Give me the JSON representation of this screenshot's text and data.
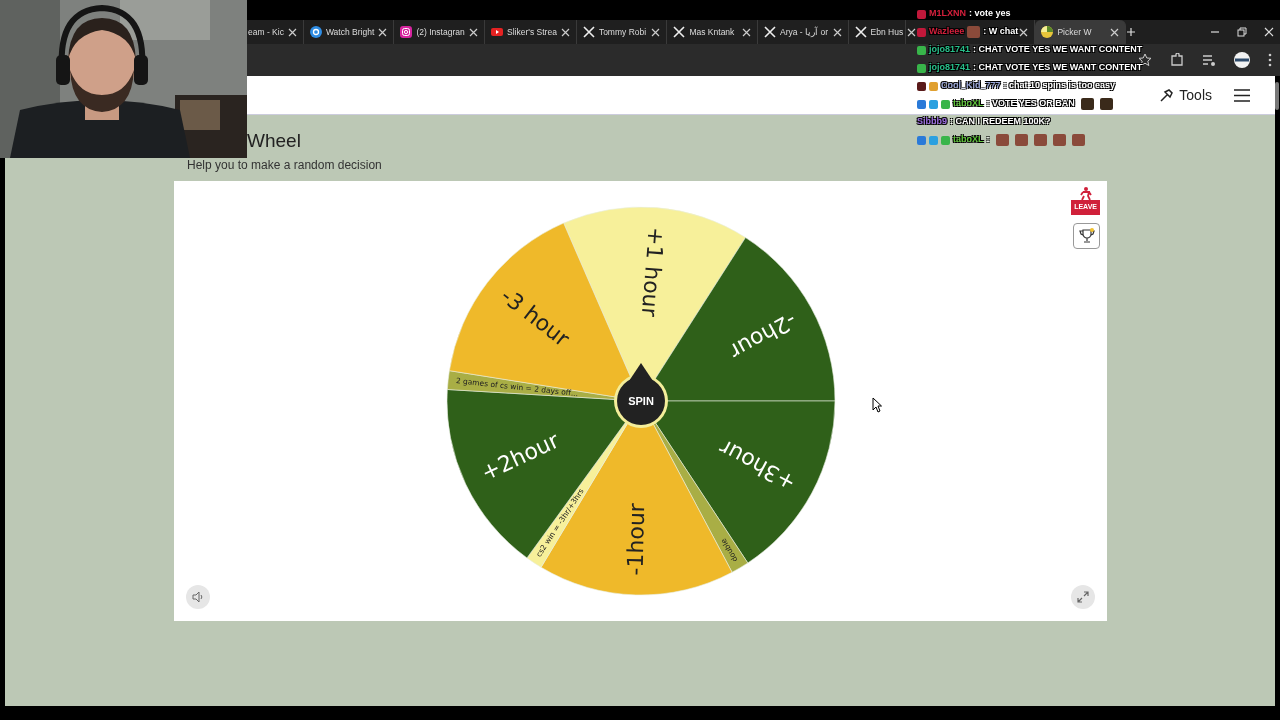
{
  "browser": {
    "tabs": [
      {
        "title": "eam - Kic",
        "kind": "plain",
        "selected": false
      },
      {
        "title": "Watch Bright",
        "kind": "ring",
        "selected": false
      },
      {
        "title": "(2) Instagran",
        "kind": "camera",
        "selected": false
      },
      {
        "title": "Sliker's Strea",
        "kind": "play",
        "selected": false
      },
      {
        "title": "Tommy Robi",
        "kind": "x",
        "selected": false
      },
      {
        "title": "Mas Kntank",
        "kind": "x",
        "selected": false
      },
      {
        "title": "Arya - آريا or",
        "kind": "x",
        "selected": false
      },
      {
        "title": "Ebn Hus",
        "kind": "x",
        "selected": false
      },
      {
        "kind": "plain",
        "selected": false
      },
      {
        "title": "Picker W",
        "kind": "wheel",
        "selected": true
      }
    ]
  },
  "chat": [
    {
      "badges": [
        {
          "color": "#c0183a"
        }
      ],
      "user": "M1LXNN",
      "color": "#d4203c",
      "message": ": vote yes"
    },
    {
      "badges": [
        {
          "color": "#c0183a"
        }
      ],
      "user": "Wazleee",
      "color": "#d4203c",
      "emotes": [
        {
          "kind": "box"
        }
      ],
      "message": ": W chat"
    },
    {
      "badges": [
        {
          "color": "#38b54a"
        }
      ],
      "user": "jojo81741",
      "color": "#27c08a",
      "message": ": CHAT VOTE YES WE WANT CONTENT"
    },
    {
      "badges": [
        {
          "color": "#38b54a"
        }
      ],
      "user": "jojo81741",
      "color": "#27c08a",
      "message": ": CHAT VOTE YES WE WANT CONTENT"
    },
    {
      "badges": [
        {
          "color": "#5a1a1a"
        },
        {
          "color": "#e0a030"
        }
      ],
      "user": "Cool_Kid_777",
      "color": "#9aa6d8",
      "message": ": chat 10 spins is too easy"
    },
    {
      "badges": [
        {
          "color": "#2a7ad8"
        },
        {
          "color": "#2aa0e0"
        },
        {
          "color": "#38b54a"
        }
      ],
      "user": "taboXL",
      "color": "#5ec43a",
      "message": ": VOTE YES OR BAN",
      "emotes_after": [
        {
          "kind": "mask"
        },
        {
          "kind": "mask"
        }
      ]
    },
    {
      "user": "Sibbb9",
      "color": "#9b6ce0",
      "message": ": CAN I REDEEM 100K?"
    },
    {
      "badges": [
        {
          "color": "#2a7ad8"
        },
        {
          "color": "#2aa0e0"
        },
        {
          "color": "#38b54a"
        }
      ],
      "user": "taboXL",
      "color": "#5ec43a",
      "message": ":",
      "emotes_after": [
        {
          "kind": "box"
        },
        {
          "kind": "box"
        },
        {
          "kind": "box"
        },
        {
          "kind": "box"
        },
        {
          "kind": "box"
        }
      ]
    }
  ],
  "page": {
    "tools": "Tools",
    "title": "Wheel",
    "subtitle": "Help you to make a random decision",
    "leave": "LEAVE",
    "spin": "SPIN",
    "segments": [
      {
        "label": "+1 hour",
        "color": "#f7f09a",
        "kind": "wide"
      },
      {
        "label": "-2hour",
        "color": "#2f6019",
        "kind": "wide"
      },
      {
        "label": "+3hour",
        "color": "#2f6019",
        "kind": "wide"
      },
      {
        "label": "double",
        "color": "#a9ae45",
        "kind": "narrow"
      },
      {
        "label": "-1hour",
        "color": "#efb92a",
        "kind": "wide"
      },
      {
        "label": "cs2 win = -3hr/+3hrs",
        "color": "#f7f09a",
        "kind": "narrow"
      },
      {
        "label": "+2hour",
        "color": "#2f6019",
        "kind": "wide"
      },
      {
        "label": "2 games of cs win = 2 days off...",
        "color": "#a9ae45",
        "kind": "narrow"
      },
      {
        "label": "-3 hour",
        "color": "#efb92a",
        "kind": "wide"
      }
    ]
  }
}
